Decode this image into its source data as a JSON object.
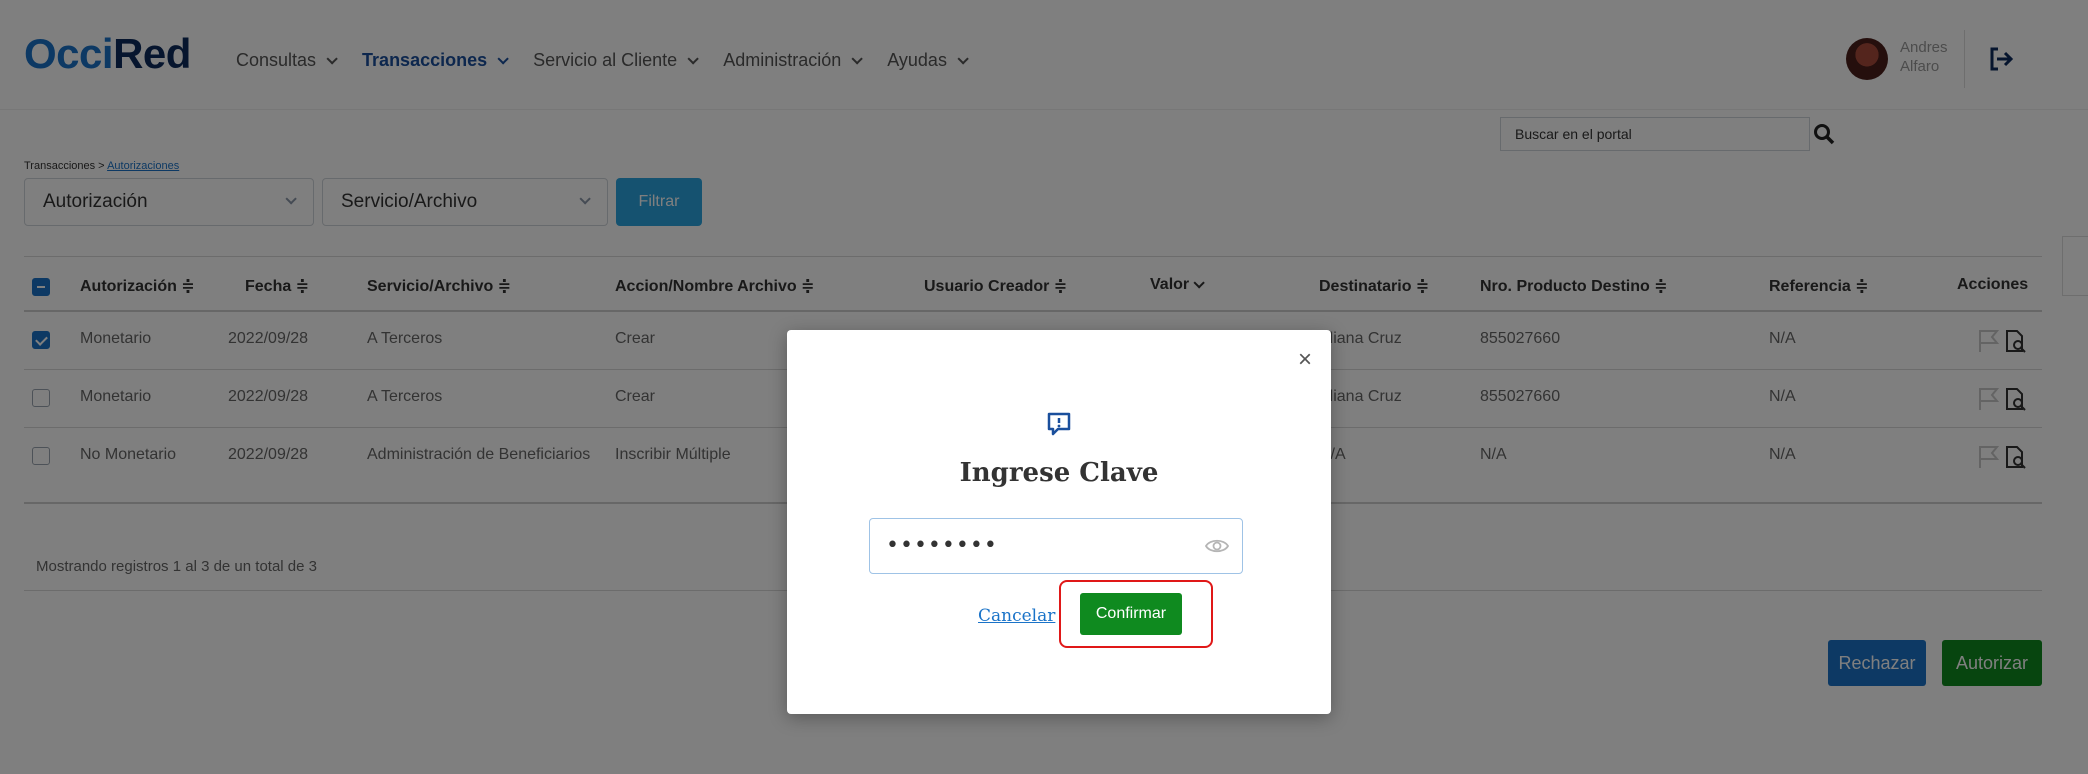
{
  "logo": {
    "part1": "Occi",
    "part2": "Red"
  },
  "nav": [
    {
      "label": "Consultas",
      "active": false
    },
    {
      "label": "Transacciones",
      "active": true
    },
    {
      "label": "Servicio al Cliente",
      "active": false
    },
    {
      "label": "Administración",
      "active": false
    },
    {
      "label": "Ayudas",
      "active": false
    }
  ],
  "user": {
    "first_name": "Andres",
    "last_name": "Alfaro"
  },
  "search": {
    "placeholder": "Buscar en el portal"
  },
  "breadcrumb": {
    "root": "Transacciones",
    "sep": " > ",
    "current": "Autorizaciones"
  },
  "filters": {
    "select1": "Autorización",
    "select2": "Servicio/Archivo",
    "button": "Filtrar"
  },
  "table": {
    "headers": [
      "Autorización ≑",
      "Fecha ≑",
      "Servicio/Archivo ≑",
      "Accion/Nombre Archivo ≑",
      "Usuario Creador ≑",
      "Valor",
      "Destinatario ≑",
      "Nro. Producto Destino ≑",
      "Referencia ≑",
      "Acciones"
    ],
    "rows": [
      {
        "checked": true,
        "cells": [
          "Monetario",
          "2022/09/28",
          "A Terceros",
          "Crear",
          "",
          "",
          "Eliana Cruz",
          "855027660",
          "N/A"
        ]
      },
      {
        "checked": false,
        "cells": [
          "Monetario",
          "2022/09/28",
          "A Terceros",
          "Crear",
          "",
          "",
          "Eliana Cruz",
          "855027660",
          "N/A"
        ]
      },
      {
        "checked": false,
        "cells": [
          "No Monetario",
          "2022/09/28",
          "Administración de Beneficiarios",
          "Inscribir Múltiple",
          "",
          "",
          "N/A",
          "N/A",
          "N/A"
        ]
      }
    ],
    "footer": "Mostrando registros 1 al 3 de un total de 3"
  },
  "buttons": {
    "reject": "Rechazar",
    "authorize": "Autorizar"
  },
  "modal": {
    "title": "Ingrese Clave",
    "password_value": "••••••••",
    "cancel": "Cancelar",
    "confirm": "Confirmar",
    "close": "×"
  },
  "colors": {
    "primary": "#1a73c8",
    "success": "#0f8a1f",
    "filter": "#2aa5e0",
    "highlight": "#e01818"
  }
}
